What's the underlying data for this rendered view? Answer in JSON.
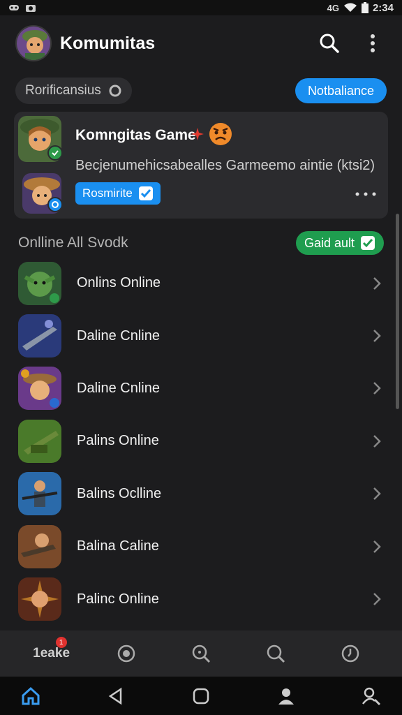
{
  "status_bar": {
    "left_icons": [
      "game-controller-icon",
      "camera-icon"
    ],
    "time": "2:34",
    "signal_text": "4G"
  },
  "header": {
    "title": "Komumitas",
    "icons": [
      "search-icon",
      "more-vert-icon"
    ]
  },
  "chips": {
    "search_chip_label": "Rorificansius",
    "primary_button_label": "Notbaliance"
  },
  "featured": {
    "title": "Komngitas Game",
    "subtitle": "Becjenumehicsabealles Garmeemo aintie (ktsi2)",
    "button_label": "Rosmirite",
    "colors": {
      "accent": "#1a8ff0",
      "card": "#2b2b2e"
    }
  },
  "section": {
    "title": "Onlline All Svodk",
    "button_label": "Gaid ault"
  },
  "list": {
    "items": [
      {
        "label": "Onlins Online",
        "icon": "goblin-icon"
      },
      {
        "label": "Daline Cnline",
        "icon": "rifle-icon"
      },
      {
        "label": "Daline Cnline",
        "icon": "cowgirl-icon"
      },
      {
        "label": "Palins Online",
        "icon": "tank-icon"
      },
      {
        "label": "Balins Oclline",
        "icon": "soldier-icon"
      },
      {
        "label": "Balina Caline",
        "icon": "gunner-icon"
      },
      {
        "label": "Palinc Online",
        "icon": "warrior-icon"
      }
    ]
  },
  "bottom_tabs": {
    "first_label": "1eake",
    "badge_count": "1",
    "icons": [
      "compass-icon",
      "search-plus-icon",
      "search-icon",
      "clock-icon"
    ]
  },
  "nav_bar": {
    "icons": [
      "home-icon",
      "back-icon",
      "home-square-icon",
      "person-icon",
      "profile-search-icon"
    ]
  }
}
